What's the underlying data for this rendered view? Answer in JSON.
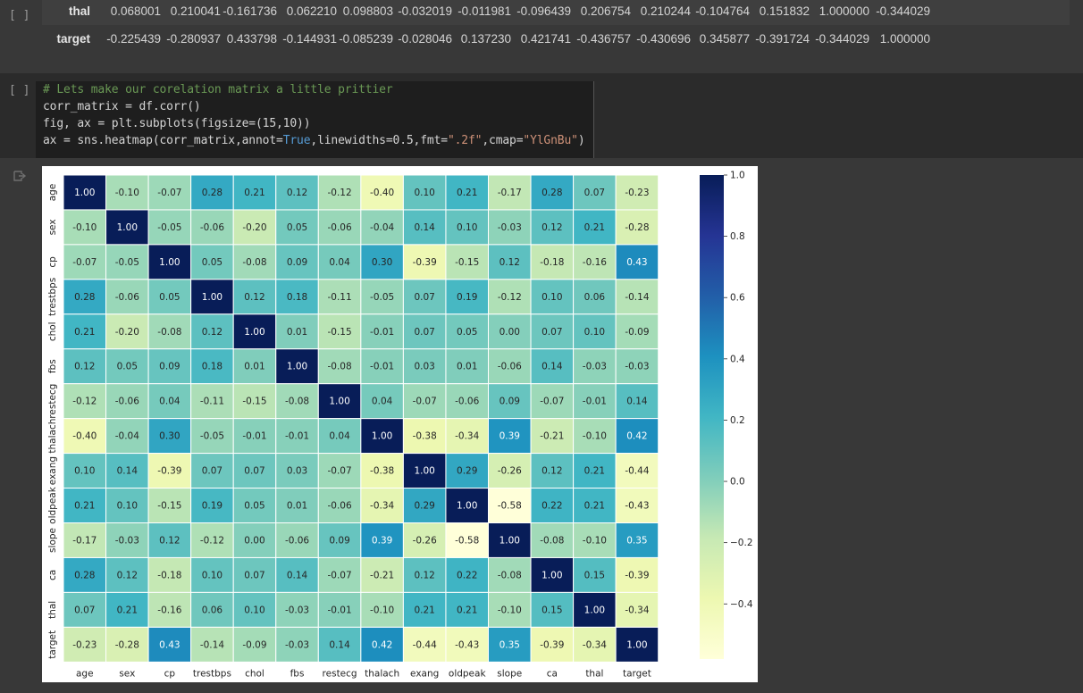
{
  "dataframe": {
    "columns": [
      "thal",
      "target"
    ],
    "rows": [
      {
        "label": "thal",
        "values": [
          "0.068001",
          "0.210041",
          "-0.161736",
          "0.062210",
          "0.098803",
          "-0.032019",
          "-0.011981",
          "-0.096439",
          "0.206754",
          "0.210244",
          "-0.104764",
          "0.151832",
          "1.000000",
          "-0.344029"
        ]
      },
      {
        "label": "target",
        "values": [
          "-0.225439",
          "-0.280937",
          "0.433798",
          "-0.144931",
          "-0.085239",
          "-0.028046",
          "0.137230",
          "0.421741",
          "-0.436757",
          "-0.430696",
          "0.345877",
          "-0.391724",
          "-0.344029",
          "1.000000"
        ]
      }
    ]
  },
  "cell_gutters": {
    "top": "[ ]",
    "code": "[ ]"
  },
  "code": {
    "line1": "# Lets make our corelation matrix a little prittier",
    "line2": "corr_matrix = df.corr()",
    "line3a": "fig, ax = plt.subplots(figsize=(15,10))",
    "line4_pre": "ax = sns.heatmap(corr_matrix,annot=",
    "line4_kw": "True",
    "line4_mid": ",linewidths=0.5,fmt=",
    "line4_str1": "\".2f\"",
    "line4_mid2": ",cmap=",
    "line4_str2": "\"YlGnBu\"",
    "line4_end": ")"
  },
  "chart_data": {
    "type": "heatmap",
    "cmap": "YlGnBu",
    "labels": [
      "age",
      "sex",
      "cp",
      "trestbps",
      "chol",
      "fbs",
      "restecg",
      "thalach",
      "exang",
      "oldpeak",
      "slope",
      "ca",
      "thal",
      "target"
    ],
    "matrix": [
      [
        1.0,
        -0.1,
        -0.07,
        0.28,
        0.21,
        0.12,
        -0.12,
        -0.4,
        0.1,
        0.21,
        -0.17,
        0.28,
        0.07,
        -0.23
      ],
      [
        -0.1,
        1.0,
        -0.05,
        -0.06,
        -0.2,
        0.05,
        -0.06,
        -0.04,
        0.14,
        0.1,
        -0.03,
        0.12,
        0.21,
        -0.28
      ],
      [
        -0.07,
        -0.05,
        1.0,
        0.05,
        -0.08,
        0.09,
        0.04,
        0.3,
        -0.39,
        -0.15,
        0.12,
        -0.18,
        -0.16,
        0.43
      ],
      [
        0.28,
        -0.06,
        0.05,
        1.0,
        0.12,
        0.18,
        -0.11,
        -0.05,
        0.07,
        0.19,
        -0.12,
        0.1,
        0.06,
        -0.14
      ],
      [
        0.21,
        -0.2,
        -0.08,
        0.12,
        1.0,
        0.01,
        -0.15,
        -0.01,
        0.07,
        0.05,
        -0.0,
        0.07,
        0.1,
        -0.09
      ],
      [
        0.12,
        0.05,
        0.09,
        0.18,
        0.01,
        1.0,
        -0.08,
        -0.01,
        0.03,
        0.01,
        -0.06,
        0.14,
        -0.03,
        -0.03
      ],
      [
        -0.12,
        -0.06,
        0.04,
        -0.11,
        -0.15,
        -0.08,
        1.0,
        0.04,
        -0.07,
        -0.06,
        0.09,
        -0.07,
        -0.01,
        0.14
      ],
      [
        -0.4,
        -0.04,
        0.3,
        -0.05,
        -0.01,
        -0.01,
        0.04,
        1.0,
        -0.38,
        -0.34,
        0.39,
        -0.21,
        -0.1,
        0.42
      ],
      [
        0.1,
        0.14,
        -0.39,
        0.07,
        0.07,
        0.03,
        -0.07,
        -0.38,
        1.0,
        0.29,
        -0.26,
        0.12,
        0.21,
        -0.44
      ],
      [
        0.21,
        0.1,
        -0.15,
        0.19,
        0.05,
        0.01,
        -0.06,
        -0.34,
        0.29,
        1.0,
        -0.58,
        0.22,
        0.21,
        -0.43
      ],
      [
        -0.17,
        -0.03,
        0.12,
        -0.12,
        -0.0,
        -0.06,
        0.09,
        0.39,
        -0.26,
        -0.58,
        1.0,
        -0.08,
        -0.1,
        0.35
      ],
      [
        0.28,
        0.12,
        -0.18,
        0.1,
        0.07,
        0.14,
        -0.07,
        -0.21,
        0.12,
        0.22,
        -0.08,
        1.0,
        0.15,
        -0.39
      ],
      [
        0.07,
        0.21,
        -0.16,
        0.06,
        0.1,
        -0.03,
        -0.01,
        -0.1,
        0.21,
        0.21,
        -0.1,
        0.15,
        1.0,
        -0.34
      ],
      [
        -0.23,
        -0.28,
        0.43,
        -0.14,
        -0.09,
        -0.03,
        0.14,
        0.42,
        -0.44,
        -0.43,
        0.35,
        -0.39,
        -0.34,
        1.0
      ]
    ],
    "vmin": -0.58,
    "vmax": 1.0,
    "colorbar_ticks": [
      1.0,
      0.8,
      0.6,
      0.4,
      0.2,
      0.0,
      -0.2,
      -0.4
    ],
    "colorbar_tick_labels": [
      "1.0",
      "0.8",
      "0.6",
      "0.4",
      "0.2",
      "0.0",
      "−0.2",
      "−0.4"
    ]
  }
}
